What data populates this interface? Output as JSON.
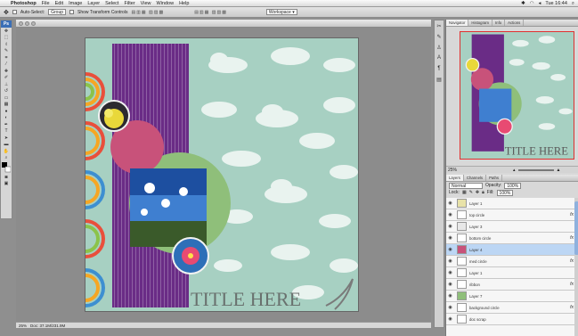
{
  "menubar": {
    "app": "Photoshop",
    "items": [
      "File",
      "Edit",
      "Image",
      "Layer",
      "Select",
      "Filter",
      "View",
      "Window",
      "Help"
    ],
    "clock": "Tue 16:44"
  },
  "options": {
    "auto_select_label": "Auto-Select:",
    "auto_select_value": "Group",
    "transform_label": "Show Transform Controls",
    "workspace_label": "Workspace ▾"
  },
  "toolbox": {
    "logo": "Ps",
    "tools": [
      "move-tool",
      "marquee-tool",
      "lasso-tool",
      "quick-select-tool",
      "crop-tool",
      "eyedropper-tool",
      "healing-tool",
      "brush-tool",
      "clone-stamp-tool",
      "history-brush-tool",
      "eraser-tool",
      "gradient-tool",
      "blur-tool",
      "dodge-tool",
      "pen-tool",
      "type-tool",
      "path-select-tool",
      "shape-tool",
      "hand-tool",
      "zoom-tool",
      "color-swatches",
      "quick-mask",
      "screen-mode"
    ]
  },
  "document": {
    "zoom": "25%",
    "status": "Doc: 37.1M/231.9M",
    "title_text": "TITLE HERE"
  },
  "navigator": {
    "tabs": [
      "Navigator",
      "Histogram",
      "Info",
      "Actions"
    ],
    "zoom": "25%",
    "title_text": "TITLE HERE"
  },
  "layers_panel": {
    "tabs": [
      "Layers",
      "Channels",
      "Paths"
    ],
    "blend_mode": "Normal",
    "opacity_label": "Opacity:",
    "opacity": "100%",
    "lock_label": "Lock:",
    "fill_label": "Fill:",
    "fill": "100%",
    "rows": [
      {
        "name": "Layer 1",
        "thumb": "#e8e2a8",
        "fx": "",
        "type": "layer"
      },
      {
        "name": "top circle",
        "thumb": "#ffffff",
        "fx": "fx",
        "type": "layer"
      },
      {
        "name": "Layer 3",
        "thumb": "#e8e8e8",
        "fx": "",
        "type": "layer"
      },
      {
        "name": "bottom circle",
        "thumb": "#ffffff",
        "fx": "fx",
        "type": "layer"
      },
      {
        "name": "Layer 4",
        "thumb": "#c8527a",
        "fx": "",
        "type": "selected"
      },
      {
        "name": "med circle",
        "thumb": "#ffffff",
        "fx": "fx",
        "type": "layer"
      },
      {
        "name": "Layer 1",
        "thumb": "#ffffff",
        "fx": "",
        "type": "layer"
      },
      {
        "name": "ribbon",
        "thumb": "#ffffff",
        "fx": "fx",
        "type": "layer"
      },
      {
        "name": "Layer 7",
        "thumb": "#8fbf7a",
        "fx": "",
        "type": "layer"
      },
      {
        "name": "background circle",
        "thumb": "#ffffff",
        "fx": "fx",
        "type": "layer"
      },
      {
        "name": "doc scrap",
        "thumb": "#ffffff",
        "fx": "",
        "type": "layer"
      }
    ]
  },
  "colors": {
    "paper": "#a7d0c2",
    "purple": "#6a2c86",
    "pink": "#c8527a",
    "green": "#8fbf7a",
    "selection": "#bcd6f4",
    "nav_frame": "#e03030"
  }
}
